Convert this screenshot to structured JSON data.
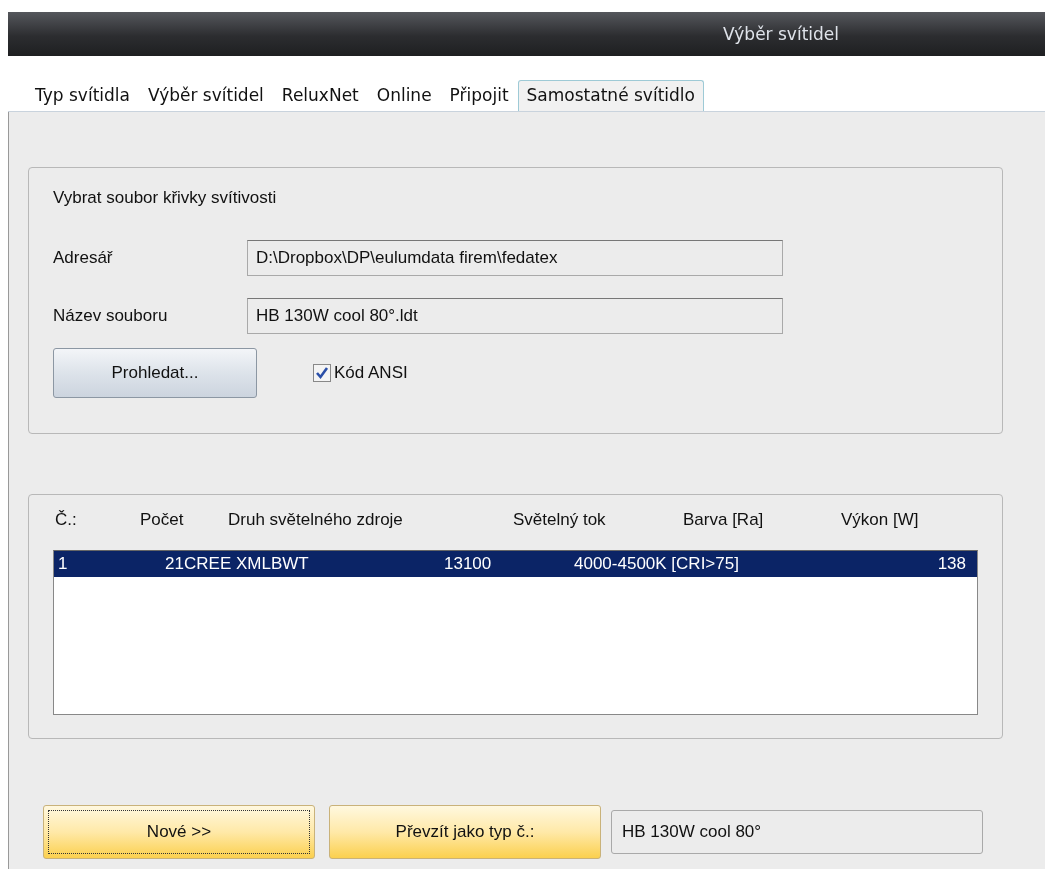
{
  "window": {
    "title": "Výběr svítidel"
  },
  "tabs": [
    {
      "label": "Typ svítidla",
      "selected": false
    },
    {
      "label": "Výběr svítidel",
      "selected": false
    },
    {
      "label": "ReluxNet",
      "selected": false
    },
    {
      "label": "Online",
      "selected": false
    },
    {
      "label": "Připojit",
      "selected": false
    },
    {
      "label": "Samostatné svítidlo",
      "selected": true
    }
  ],
  "file_group": {
    "title": "Vybrat soubor křivky svítivosti",
    "fields": [
      {
        "label": "Adresář",
        "value": "D:\\Dropbox\\DP\\eulumdata firem\\fedatex"
      },
      {
        "label": "Název souboru",
        "value": "HB 130W cool 80°.ldt"
      }
    ],
    "browse_button": "Prohledat...",
    "ansi_checkbox": {
      "label": "Kód ANSI",
      "checked": true
    }
  },
  "table": {
    "columns": [
      "Č.:",
      "Počet",
      "Druh světelného zdroje",
      "Světelný tok",
      "Barva [Ra]",
      "Výkon [W]"
    ],
    "rows": [
      {
        "cells": [
          "1",
          "21",
          "CREE XMLBWT",
          "13100",
          "4000-4500K [CRI>75]",
          "138"
        ],
        "selected": true
      }
    ]
  },
  "buttons": [
    {
      "label": "Nové >>",
      "focused": true
    },
    {
      "label": "Převzít jako typ č.:",
      "focused": false
    }
  ],
  "type_field": {
    "value": "HB 130W cool 80°"
  }
}
